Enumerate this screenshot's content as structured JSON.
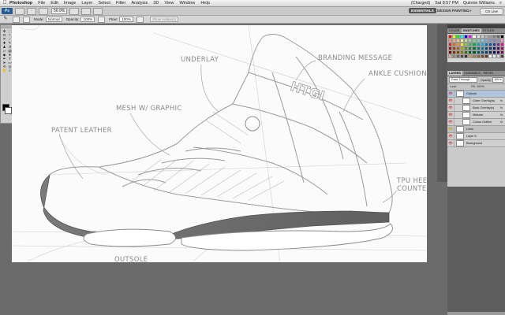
{
  "menubar": {
    "apple": "",
    "app_name": "Photoshop",
    "items": [
      "File",
      "Edit",
      "Image",
      "Layer",
      "Select",
      "Filter",
      "Analysis",
      "3D",
      "View",
      "Window",
      "Help"
    ],
    "status": {
      "battery": "(Charged)",
      "clock": "Sat 8:57 PM",
      "user": "Quinnie Williams"
    }
  },
  "appbar": {
    "logo": "Ps",
    "zoom": "50.9%",
    "workspaces": {
      "active": "ESSENTIALS",
      "second": "DESIGN",
      "third": "PAINTING",
      "more": "»"
    },
    "cs_live": "CS Live"
  },
  "optionsbar": {
    "tool_icon": "brush-icon",
    "mode_label": "Mode:",
    "mode_value": "Normal",
    "opacity_label": "Opacity:",
    "opacity_value": "100%",
    "flow_label": "Flow:",
    "flow_value": "100%",
    "checkbox_label": "Show Isolate(s)"
  },
  "canvas": {
    "annotations": {
      "top": "UNDERLAY",
      "branding": "BRANDING MESSAGE",
      "ankle": "ANKLE CUSHION",
      "mesh": "MESH W/ GRAPHIC",
      "leather": "PATENT LEATHER",
      "tpu1": "TPU HEEL",
      "tpu2": "COUNTER",
      "bottom": "OUTSOLE",
      "heel_brand": "HTGI"
    }
  },
  "panels": {
    "swatch_tabs": [
      "COLOR",
      "SWATCHES",
      "STYLES"
    ],
    "layer_tabs": [
      "LAYERS",
      "CHANNELS",
      "PATHS"
    ],
    "blend_mode": "Pass Through",
    "opacity_label": "Opacity:",
    "opacity_value": "100%",
    "lock_label": "Lock:",
    "fill_label": "Fill:",
    "fill_value": "100%",
    "layers": [
      {
        "name": "Outsole",
        "type": "group",
        "eye": "👁",
        "fx": ""
      },
      {
        "name": "Outer Overlay(s)",
        "type": "layer",
        "eye": "👁",
        "fx": "fx"
      },
      {
        "name": "Back Overlay(s)",
        "type": "layer",
        "eye": "👁",
        "fx": "fx"
      },
      {
        "name": "Midsole",
        "type": "layer",
        "eye": "👁",
        "fx": "fx"
      },
      {
        "name": "Colour Outline",
        "type": "layer",
        "eye": "👁",
        "fx": "fx"
      },
      {
        "name": "Lines",
        "type": "group2",
        "eye": "👁",
        "fx": ""
      },
      {
        "name": "Layer 5",
        "type": "layer",
        "eye": "👁",
        "fx": ""
      },
      {
        "name": "Background",
        "type": "layer",
        "eye": "👁",
        "fx": ""
      }
    ],
    "colors": {
      "swatch_row1": [
        "#ff0000",
        "#ffff00",
        "#00ff00",
        "#00ffff",
        "#0000ff",
        "#ff00ff",
        "#ffffff",
        "#e6e6e6",
        "#cccccc",
        "#b3b3b3",
        "#999999",
        "#808080",
        "#666666",
        "#000000"
      ],
      "swatch_row2": [
        "#f7977a",
        "#f9ad81",
        "#fdc68a",
        "#fff79a",
        "#c4df9b",
        "#a2d39c",
        "#82ca9d",
        "#7bcdc8",
        "#6ecff6",
        "#7ea7d8",
        "#8493ca",
        "#8882be",
        "#a187be",
        "#f49ac2"
      ],
      "swatch_row3": [
        "#ed1c24",
        "#f26522",
        "#f7941d",
        "#fff200",
        "#8dc63f",
        "#39b54a",
        "#00a651",
        "#00a99d",
        "#00aeef",
        "#0072bc",
        "#0054a6",
        "#2e3192",
        "#662d91",
        "#ec008c"
      ],
      "swatch_row4": [
        "#9e0b0f",
        "#a0410d",
        "#a36209",
        "#aba000",
        "#598527",
        "#1a7b30",
        "#007236",
        "#00746b",
        "#0076a3",
        "#004b80",
        "#003471",
        "#1b1464",
        "#440e62",
        "#9e005d"
      ],
      "swatch_row5": [
        "#790000",
        "#7b2e00",
        "#7d4900",
        "#827b00",
        "#406618",
        "#005e20",
        "#005826",
        "#005952",
        "#005b7f",
        "#003663",
        "#002157",
        "#0d004c",
        "#32004b",
        "#7b0046"
      ],
      "swatch_row6": [
        "#c7b299",
        "#998675",
        "#736357",
        "#534741",
        "#37302d",
        "#c69c6d",
        "#a67c52",
        "#8c6239",
        "#754c24",
        "#603913",
        "#ffffff",
        "#f2f2f2",
        "#d9d9d9",
        "#404040"
      ]
    }
  }
}
